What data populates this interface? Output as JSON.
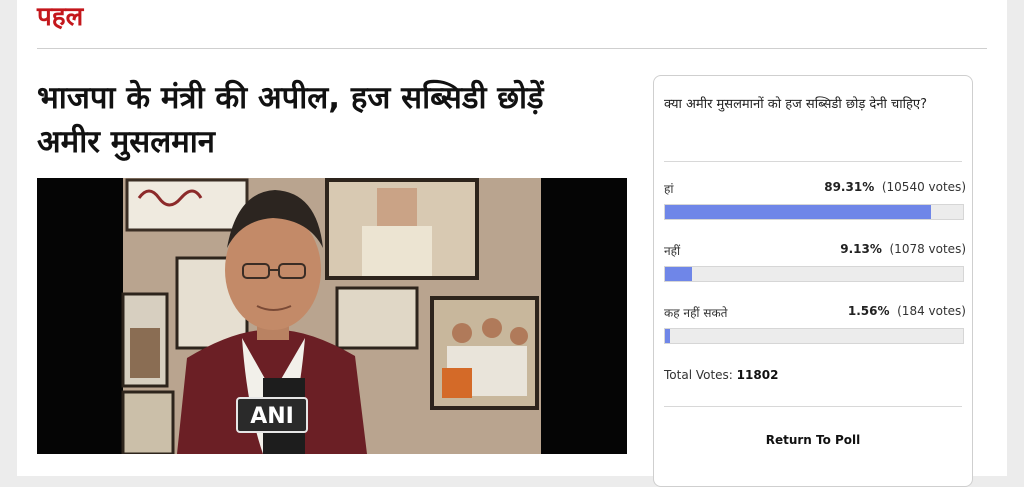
{
  "section": {
    "label": "पहल"
  },
  "article": {
    "headline": "भाजपा के मंत्री की अपील, हज सब्सिडी छोड़ें अमीर मुसलमान",
    "video_logo": "ANI"
  },
  "poll": {
    "question": "क्या अमीर मुसलमानों को हज सब्सिडी छोड़ देनी चाहिए?",
    "options": [
      {
        "label": "हां",
        "percent": "89.31%",
        "votes": "(10540 votes)",
        "fraction": 0.8931
      },
      {
        "label": "नहीं",
        "percent": "9.13%",
        "votes": "(1078 votes)",
        "fraction": 0.0913
      },
      {
        "label": "कह नहीं सकते",
        "percent": "1.56%",
        "votes": "(184 votes)",
        "fraction": 0.0156
      }
    ],
    "total_label": "Total Votes:",
    "total_value": "11802",
    "return_label": "Return To Poll",
    "bar_color": "#6f86e8"
  }
}
